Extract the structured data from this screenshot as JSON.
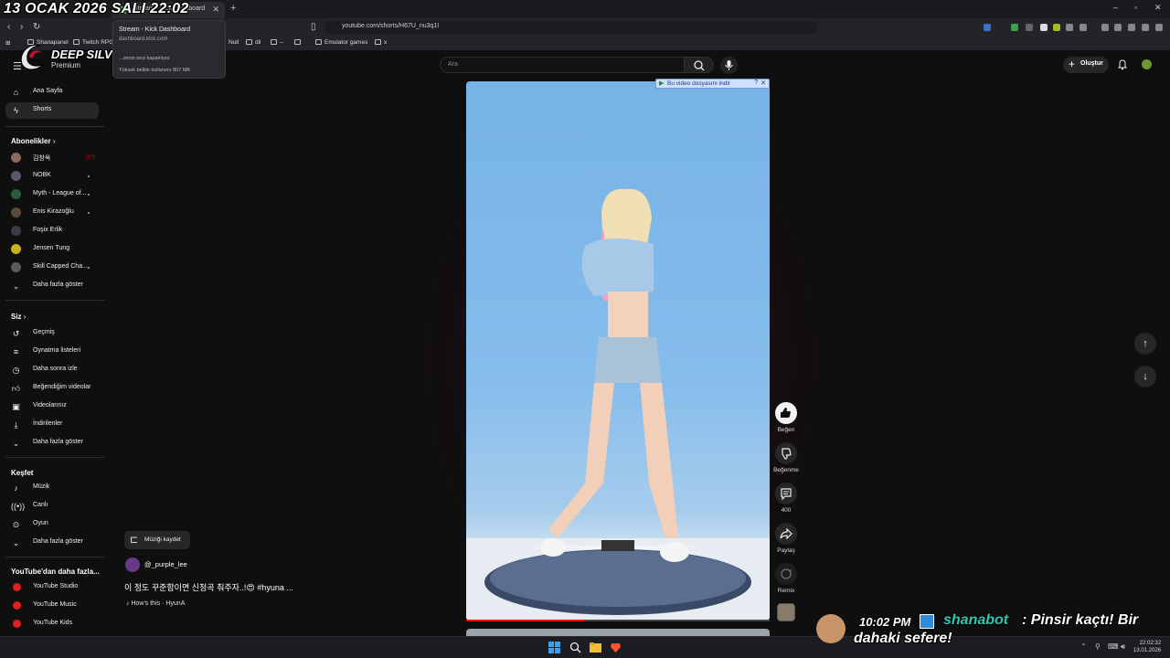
{
  "overlay": {
    "date_text": "13 OCAK 2026 SALI 22:02",
    "brand_text": "DEEP SILVER",
    "chat_time": "10:02 PM",
    "chat_user": "shanabot",
    "chat_msg_line1": ": Pinsir kaçtı! Bir",
    "chat_msg_line2": "dahaki sefere!"
  },
  "browser": {
    "tab_title": "Stream - Kick Dashboard",
    "url": "youtube.com/shorts/H67U_nu3q1I",
    "bookmarks": [
      "Shanapanel",
      "Twitch RPG",
      "Null",
      "dil",
      "--",
      "",
      "Emulator games",
      "x"
    ],
    "tab_popup": {
      "title": "Stream - Kick Dashboard",
      "url": "dashboard.kick.com",
      "line1": "...zenin sesi kapatılıyor",
      "line2": "Yüksek bellek kullanımı 807 MB"
    }
  },
  "youtube": {
    "premium_label": "Premium",
    "search_placeholder": "Ara",
    "create_label": "Oluştur",
    "sidebar": {
      "main": [
        {
          "label": "Ana Sayfa",
          "icon": "home-icon"
        },
        {
          "label": "Shorts",
          "icon": "shorts-icon"
        }
      ],
      "subscriptions_header": "Abonelikler",
      "subscriptions": [
        {
          "label": "김창옥",
          "color": "#8a6a5a",
          "indicator": "live"
        },
        {
          "label": "NOBK",
          "color": "#555a6a",
          "indicator": "dot"
        },
        {
          "label": "Myth - League of...",
          "color": "#2a5a3a",
          "indicator": "dot"
        },
        {
          "label": "Enis Kirazoğlu",
          "color": "#5a4a3a",
          "indicator": "dot"
        },
        {
          "label": "Foşix Erlik",
          "color": "#3a3a4a",
          "indicator": ""
        },
        {
          "label": "Jensen Tung",
          "color": "#c8b020",
          "indicator": ""
        },
        {
          "label": "Skill Capped Cha...",
          "color": "#5a5a5a",
          "indicator": "dot"
        }
      ],
      "subs_more": "Daha fazla göster",
      "you_header": "Siz",
      "you_items": [
        {
          "label": "Geçmiş",
          "icon": "history-icon"
        },
        {
          "label": "Oynatma listeleri",
          "icon": "playlist-icon"
        },
        {
          "label": "Daha sonra izle",
          "icon": "clock-icon"
        },
        {
          "label": "Beğendiğim videolar",
          "icon": "thumb-up-icon"
        },
        {
          "label": "Videolarınız",
          "icon": "your-videos-icon"
        },
        {
          "label": "İndirilenler",
          "icon": "download-icon"
        },
        {
          "label": "Daha fazla göster",
          "icon": "chevron-down-icon"
        }
      ],
      "explore_header": "Keşfet",
      "explore_items": [
        {
          "label": "Müzik",
          "icon": "music-icon"
        },
        {
          "label": "Canlı",
          "icon": "live-icon"
        },
        {
          "label": "Oyun",
          "icon": "game-icon"
        },
        {
          "label": "Daha fazla göster",
          "icon": "chevron-down-icon"
        }
      ],
      "more_header": "YouTube'dan daha fazla...",
      "more_items": [
        "YouTube Studio",
        "YouTube Music",
        "YouTube Kids"
      ]
    },
    "short": {
      "download_bar": "Bu video dosyasını indir",
      "save_music": "Müziği kaydet",
      "channel": "@_purple_lee",
      "title": "이 정도 꾸준함이면 신청곡 춰주자..!😍 #hyuna ...",
      "music": "How's this · HyunA",
      "progress": 0.39
    },
    "actions": {
      "like": "Beğen",
      "dislike": "Beğenme",
      "comments": "400",
      "share": "Paylaş",
      "remix": "Remix"
    }
  },
  "taskbar": {
    "time": "22:02:32",
    "date": "13.01.2026"
  }
}
